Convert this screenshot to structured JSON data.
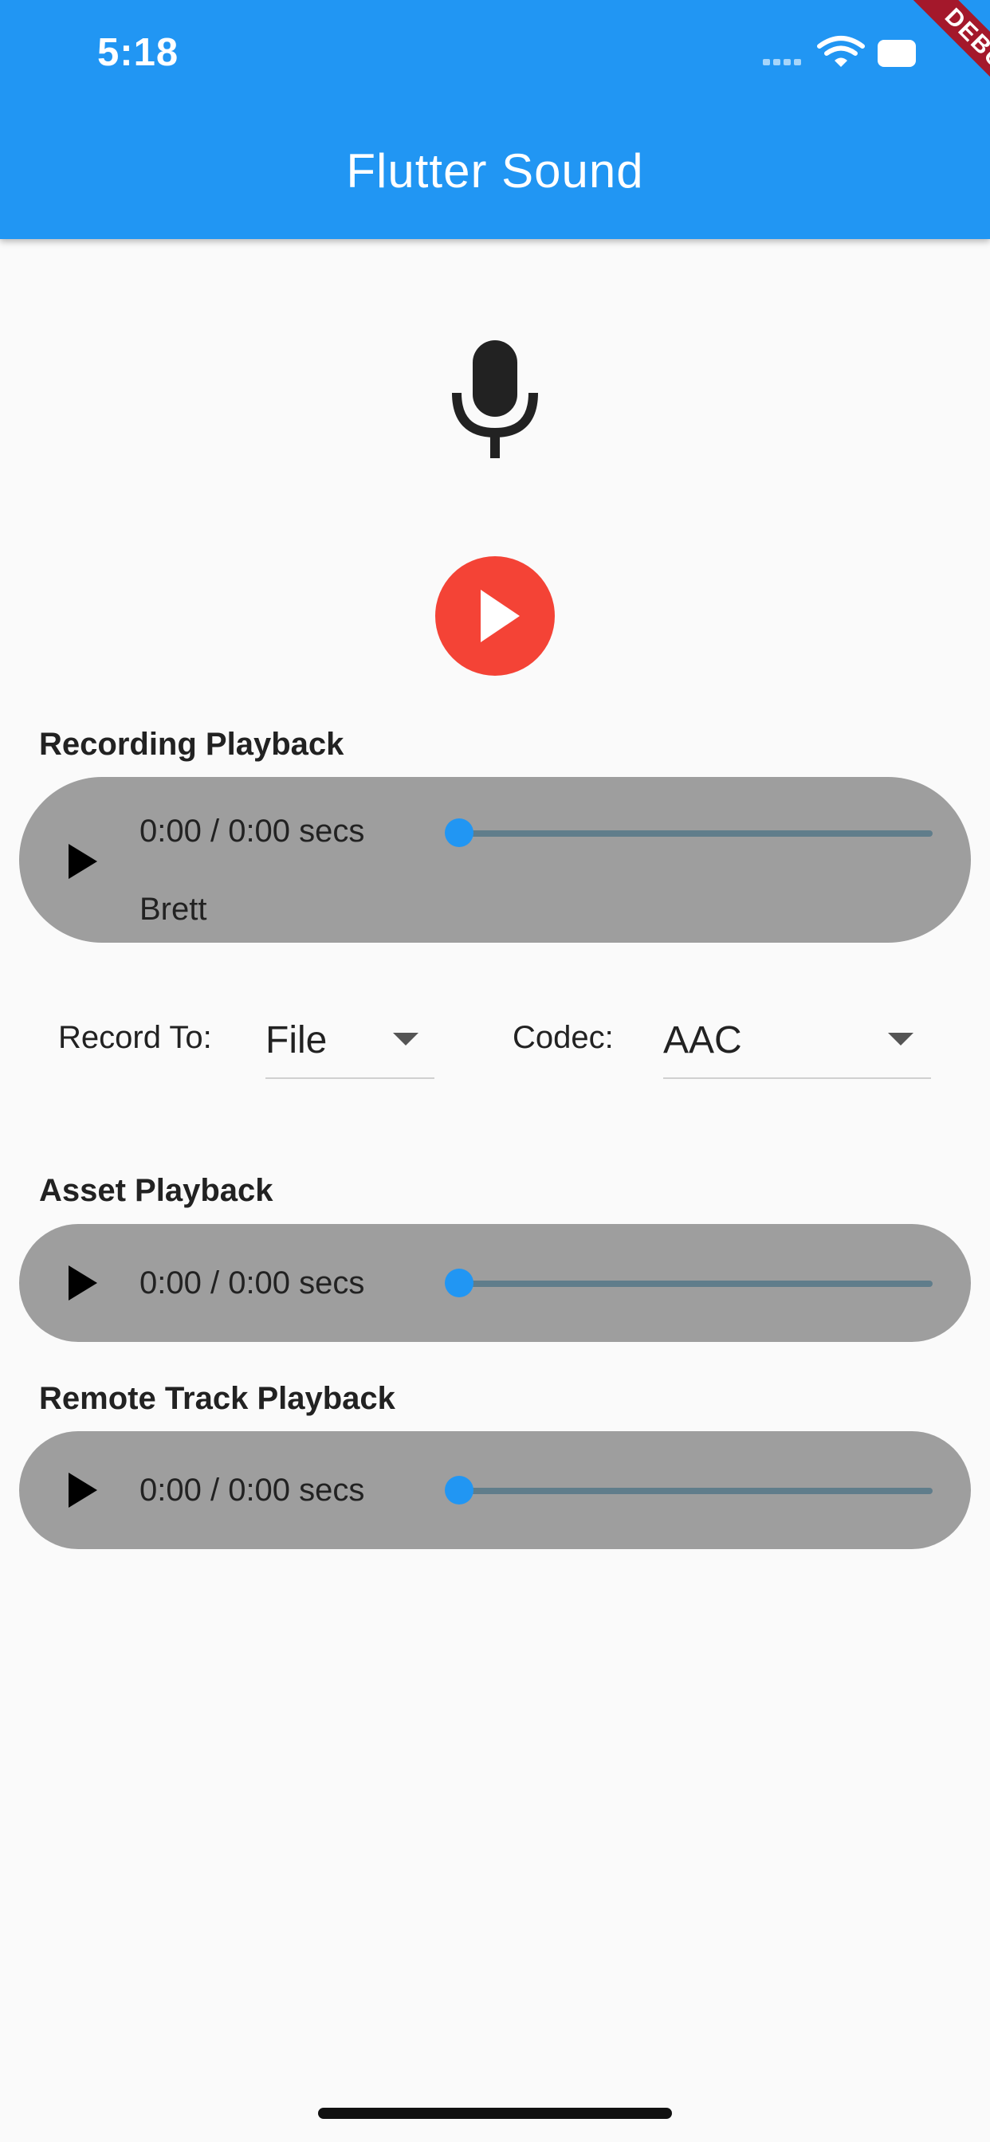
{
  "status_bar": {
    "time": "5:18"
  },
  "app_bar": {
    "title": "Flutter Sound",
    "debug_label": "DEBUG",
    "color": "#2196f3"
  },
  "recorder": {
    "mic_icon": "mic-icon",
    "record_button_icon": "play-icon",
    "record_button_color": "#f44336"
  },
  "recording_playback": {
    "title": "Recording Playback",
    "time": "0:00 / 0:00 secs",
    "subtitle": "Brett",
    "progress": 0
  },
  "options": {
    "record_to_label": "Record To:",
    "record_to_value": "File",
    "codec_label": "Codec:",
    "codec_value": "AAC"
  },
  "asset_playback": {
    "title": "Asset Playback",
    "time": "0:00 / 0:00 secs",
    "progress": 0
  },
  "remote_playback": {
    "title": "Remote Track Playback",
    "time": "0:00 / 0:00 secs",
    "progress": 0
  },
  "colors": {
    "player_background": "#9e9e9e",
    "slider_active": "#2196f3",
    "slider_track": "#607d8b"
  }
}
